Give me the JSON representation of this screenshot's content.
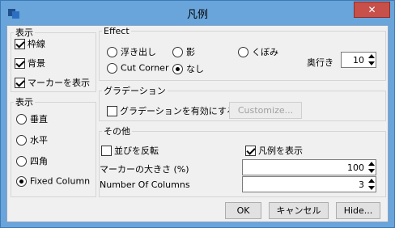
{
  "window": {
    "title": "凡例",
    "close_glyph": "✕"
  },
  "display_group": {
    "legend": "表示",
    "items": [
      {
        "label": "枠線",
        "checked": true
      },
      {
        "label": "背景",
        "checked": true
      },
      {
        "label": "マーカーを表示",
        "checked": true
      }
    ]
  },
  "orientation_group": {
    "legend": "表示",
    "options": [
      {
        "label": "垂直",
        "selected": false
      },
      {
        "label": "水平",
        "selected": false
      },
      {
        "label": "四角",
        "selected": false
      },
      {
        "label": "Fixed Column",
        "selected": true
      }
    ]
  },
  "effect_group": {
    "legend": "Effect",
    "options": [
      {
        "label": "浮き出し",
        "selected": false
      },
      {
        "label": "影",
        "selected": false
      },
      {
        "label": "くぼみ",
        "selected": false
      },
      {
        "label": "Cut Corner",
        "selected": false
      },
      {
        "label": "なし",
        "selected": true
      }
    ],
    "depth_label": "奥行き",
    "depth_value": "10"
  },
  "gradient_group": {
    "legend": "グラデーション",
    "enable_label": "グラデーションを有効にする",
    "enabled": false,
    "customize_label": "Customize..."
  },
  "other_group": {
    "legend": "その他",
    "reverse_label": "並びを反転",
    "reverse_checked": false,
    "show_legend_label": "凡例を表示",
    "show_legend_checked": true,
    "marker_size_label": "マーカーの大きさ (%)",
    "marker_size_value": "100",
    "columns_label": "Number Of Columns",
    "columns_value": "3"
  },
  "buttons": {
    "ok": "OK",
    "cancel": "キャンセル",
    "hide": "Hide..."
  }
}
